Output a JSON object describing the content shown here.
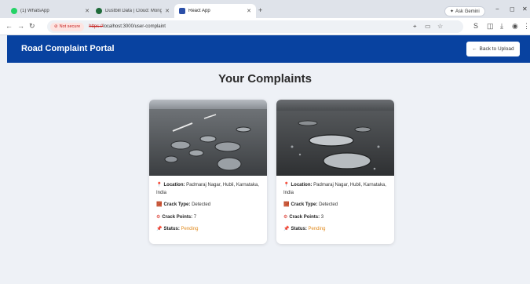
{
  "browser": {
    "tabs": [
      {
        "label": "(1) WhatsApp",
        "color": "#25d366"
      },
      {
        "label": "Dustbill Data | Cloud: MongoD",
        "color": "#1f6b3a"
      },
      {
        "label": "React App",
        "color": "#2b4fa8"
      }
    ],
    "ask_gemini": "Ask Gemini",
    "not_secure": "Not secure",
    "url_scheme": "https://",
    "url_rest": "localhost:3000/user-complaint"
  },
  "header": {
    "brand": "Road Complaint Portal",
    "back_button": "Back to Upload",
    "color": "#0842a0"
  },
  "page": {
    "title": "Your Complaints"
  },
  "complaints": [
    {
      "location_label": "Location:",
      "location": "Padmaraj Nagar, Hubli, Karnataka, India",
      "crack_type_label": "Crack Type:",
      "crack_type": "Detected",
      "crack_points_label": "Crack Points:",
      "crack_points": "7",
      "status_label": "Status:",
      "status": "Pending"
    },
    {
      "location_label": "Location:",
      "location": "Padmaraj Nagar, Hubli, Karnataka, India",
      "crack_type_label": "Crack Type:",
      "crack_type": "Detected",
      "crack_points_label": "Crack Points:",
      "crack_points": "3",
      "status_label": "Status:",
      "status": "Pending"
    }
  ],
  "colors": {
    "status_pending": "#e08a1e",
    "accent": "#0842a0"
  }
}
